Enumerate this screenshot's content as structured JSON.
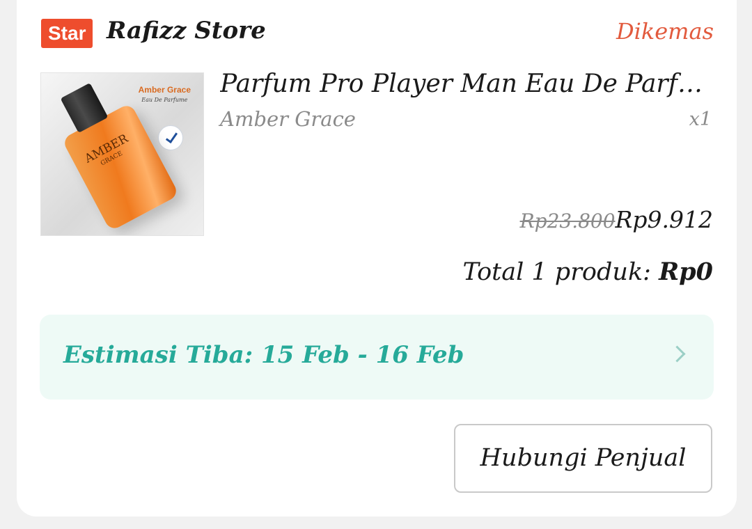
{
  "shop": {
    "badge": "Star",
    "name": "Rafizz Store",
    "status": "Dikemas"
  },
  "product": {
    "image_brand": "Amber Grace",
    "image_brand_sub": "Eau De Parfume",
    "image_bottle_text": "AMBER",
    "image_bottle_sub": "GRACE",
    "title": "Parfum Pro Player Man Eau De Parfume",
    "variant": "Amber Grace",
    "quantity": "x1",
    "price_original": "Rp23.800",
    "price_current": "Rp9.912"
  },
  "total": {
    "label": "Total 1 produk: ",
    "value": "Rp0"
  },
  "estimate": {
    "text": "Estimasi Tiba: 15 Feb - 16 Feb"
  },
  "actions": {
    "contact_seller": "Hubungi Penjual"
  },
  "colors": {
    "badge_bg": "#ee4d2d",
    "status": "#e25a3d",
    "estimate_text": "#26aa99",
    "estimate_bg": "#eefaf6"
  },
  "icons": {
    "estimate_arrow": "chevron-right-icon",
    "bpom_logo": "verified-logo-icon"
  }
}
